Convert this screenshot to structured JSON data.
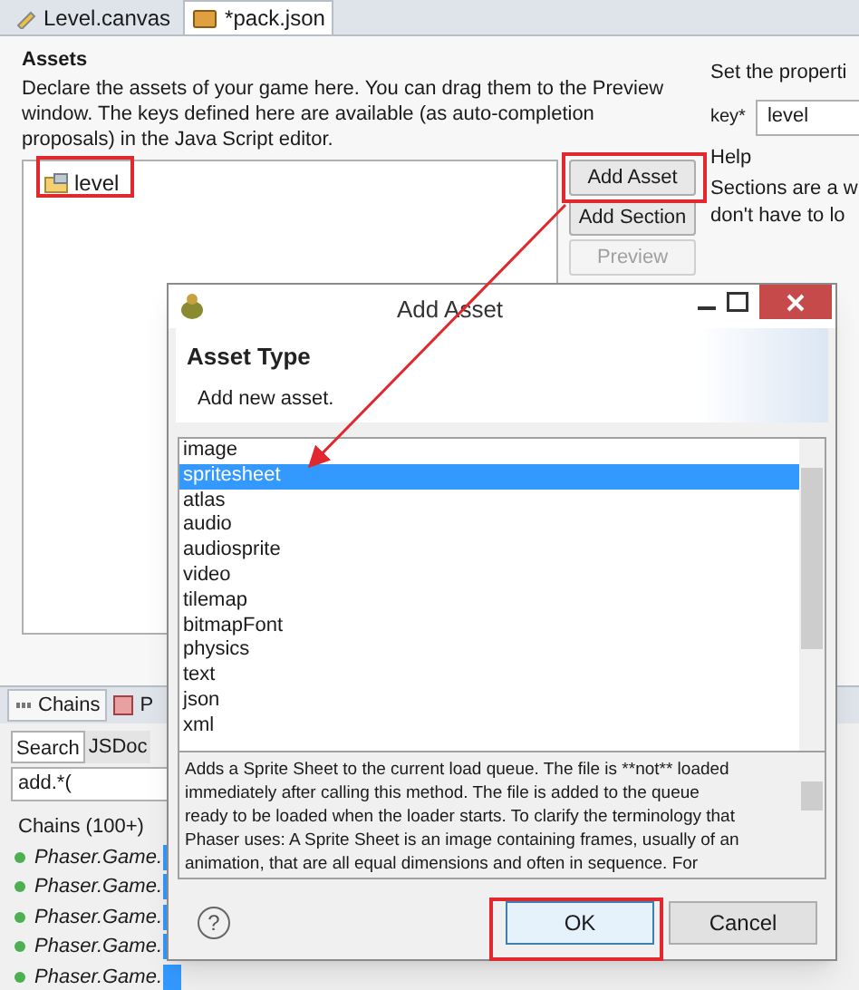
{
  "editor_tabs": [
    {
      "label": "Level.canvas",
      "selected": false,
      "kind": "canvas"
    },
    {
      "label": "*pack.json",
      "selected": true,
      "kind": "json"
    }
  ],
  "assets": {
    "title": "Assets",
    "description": "Declare the assets of your game here. You can drag them to the Preview window. The keys defined here are available (as auto-completion proposals) in the Java Script editor.",
    "items": [
      {
        "label": "level",
        "selected": false
      }
    ],
    "buttons": [
      {
        "label": "Add Asset",
        "disabled": false
      },
      {
        "label": "Add Section",
        "disabled": false
      },
      {
        "label": "Preview",
        "disabled": true
      }
    ]
  },
  "properties": {
    "heading": "Set the properti",
    "key_label": "key*",
    "key_value": "level",
    "help_title": "Help",
    "help_lines": [
      "Sections are a w",
      "don't have to lo"
    ]
  },
  "bottom_panel": {
    "tabs": [
      {
        "label": "Chains",
        "selected": true
      },
      {
        "label": "P",
        "selected": false
      }
    ],
    "subtabs": [
      {
        "label": "Search",
        "selected": true
      },
      {
        "label": "JSDoc",
        "selected": false
      }
    ],
    "search_value": "add.*(",
    "results_heading": "Chains (100+)",
    "results": [
      "Phaser.Game.",
      "Phaser.Game.",
      "Phaser.Game.",
      "Phaser.Game.",
      "Phaser.Game."
    ]
  },
  "dialog": {
    "title": "Add Asset",
    "header_title": "Asset Type",
    "header_message": "Add new asset.",
    "asset_types": [
      {
        "label": "image",
        "selected": false
      },
      {
        "label": "spritesheet",
        "selected": true
      },
      {
        "label": "atlas",
        "selected": false
      },
      {
        "label": "audio",
        "selected": false
      },
      {
        "label": "audiosprite",
        "selected": false
      },
      {
        "label": "video",
        "selected": false
      },
      {
        "label": "tilemap",
        "selected": false
      },
      {
        "label": "bitmapFont",
        "selected": false
      },
      {
        "label": "physics",
        "selected": false
      },
      {
        "label": "text",
        "selected": false
      },
      {
        "label": "json",
        "selected": false
      },
      {
        "label": "xml",
        "selected": false
      }
    ],
    "description_lines": [
      "Adds a Sprite Sheet to the current load queue. The file is **not** loaded",
      "immediately after calling this method. The file is added to the queue",
      "ready to be loaded when the loader starts. To clarify the terminology that",
      "Phaser uses: A Sprite Sheet is an image containing frames, usually of an",
      "animation, that are all equal dimensions and often in sequence. For"
    ],
    "help_glyph": "?",
    "buttons": [
      {
        "label": "OK",
        "default": true
      },
      {
        "label": "Cancel",
        "default": false
      }
    ]
  }
}
